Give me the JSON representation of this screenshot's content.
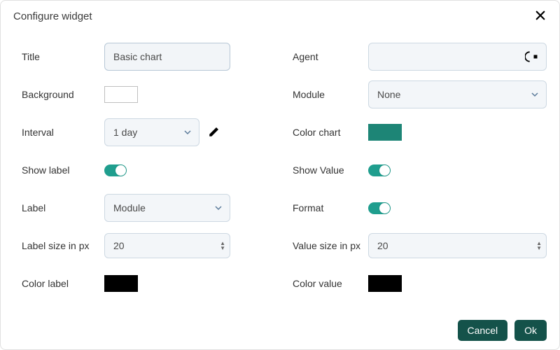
{
  "dialog": {
    "title": "Configure widget"
  },
  "left": {
    "title_label": "Title",
    "title_value": "Basic chart",
    "background_label": "Background",
    "interval_label": "Interval",
    "interval_value": "1 day",
    "show_label_label": "Show label",
    "label_label": "Label",
    "label_value": "Module",
    "label_size_label": "Label size in px",
    "label_size_value": "20",
    "color_label_label": "Color label",
    "color_label_value": "#000000"
  },
  "right": {
    "agent_label": "Agent",
    "module_label": "Module",
    "module_value": "None",
    "color_chart_label": "Color chart",
    "color_chart_value": "#1d8576",
    "show_value_label": "Show Value",
    "format_label": "Format",
    "value_size_label": "Value size in px",
    "value_size_value": "20",
    "color_value_label": "Color value",
    "color_value_value": "#000000"
  },
  "footer": {
    "cancel": "Cancel",
    "ok": "Ok"
  }
}
